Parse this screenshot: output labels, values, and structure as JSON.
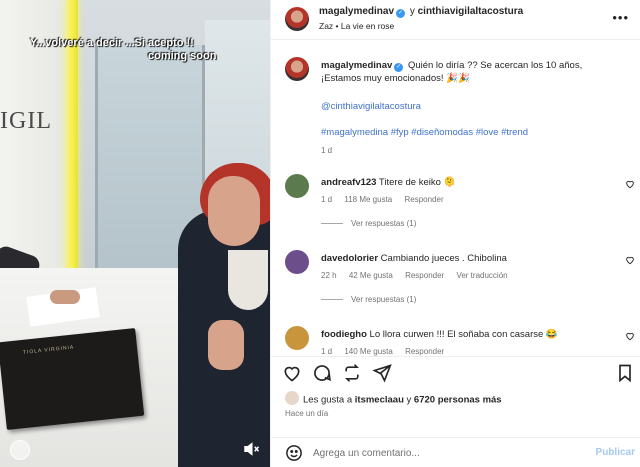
{
  "media": {
    "caption_line1": "Y...volveré a decir ...Si acepto !!",
    "caption_line2": "coming soon",
    "sign_text": "IGIL",
    "book_text": "TIOLA VIRGINIA",
    "mute_icon": "speaker-muted-icon"
  },
  "header": {
    "username": "magalymedinav",
    "joiner": "y",
    "coauthor": "cinthiavigilaltacostura",
    "subtitle": "Zaz • La vie en rose",
    "more_icon": "more-options-icon"
  },
  "caption": {
    "username": "magalymedinav",
    "text": "Quién lo diría ?? Se acercan los 10 años, ¡Estamos muy emocionados! 🎉🎉",
    "mention": "@cinthiavigilaltacostura",
    "hashtags": "#magalymedina #fyp #diseñomodas #love #trend",
    "age": "1 d"
  },
  "comments": [
    {
      "username": "andreafv123",
      "text": "Titere de keiko 🫠",
      "age": "1 d",
      "likes": "118 Me gusta",
      "reply": "Responder",
      "translate": "",
      "replies": "Ver respuestas (1)",
      "avatar_color": "#5b7a4e"
    },
    {
      "username": "davedolorier",
      "text": "Cambiando jueces . Chibolina",
      "age": "22 h",
      "likes": "42 Me gusta",
      "reply": "Responder",
      "translate": "Ver traducción",
      "replies": "Ver respuestas (1)",
      "avatar_color": "#6b4e8a"
    },
    {
      "username": "foodiegho",
      "text": "Lo llora curwen !!! El soñaba con casarse 😂",
      "age": "1 d",
      "likes": "140 Me gusta",
      "reply": "Responder",
      "translate": "",
      "replies": "",
      "avatar_color": "#c9953c"
    }
  ],
  "actions": {
    "like_icon": "heart-icon",
    "comment_icon": "comment-bubble-icon",
    "share_icon": "paper-plane-icon",
    "save_icon": "bookmark-icon"
  },
  "likes": {
    "prefix": "Les gusta a",
    "user": "itsmeclaau",
    "middle": "y",
    "count": "6720 personas más"
  },
  "timestamp": "Hace un día",
  "composer": {
    "placeholder": "Agrega un comentario...",
    "publish": "Publicar"
  },
  "colors": {
    "link": "#00376b",
    "hashtag": "#3f72c9",
    "verified": "#3897f0",
    "publish_disabled": "#a8c9ef"
  }
}
